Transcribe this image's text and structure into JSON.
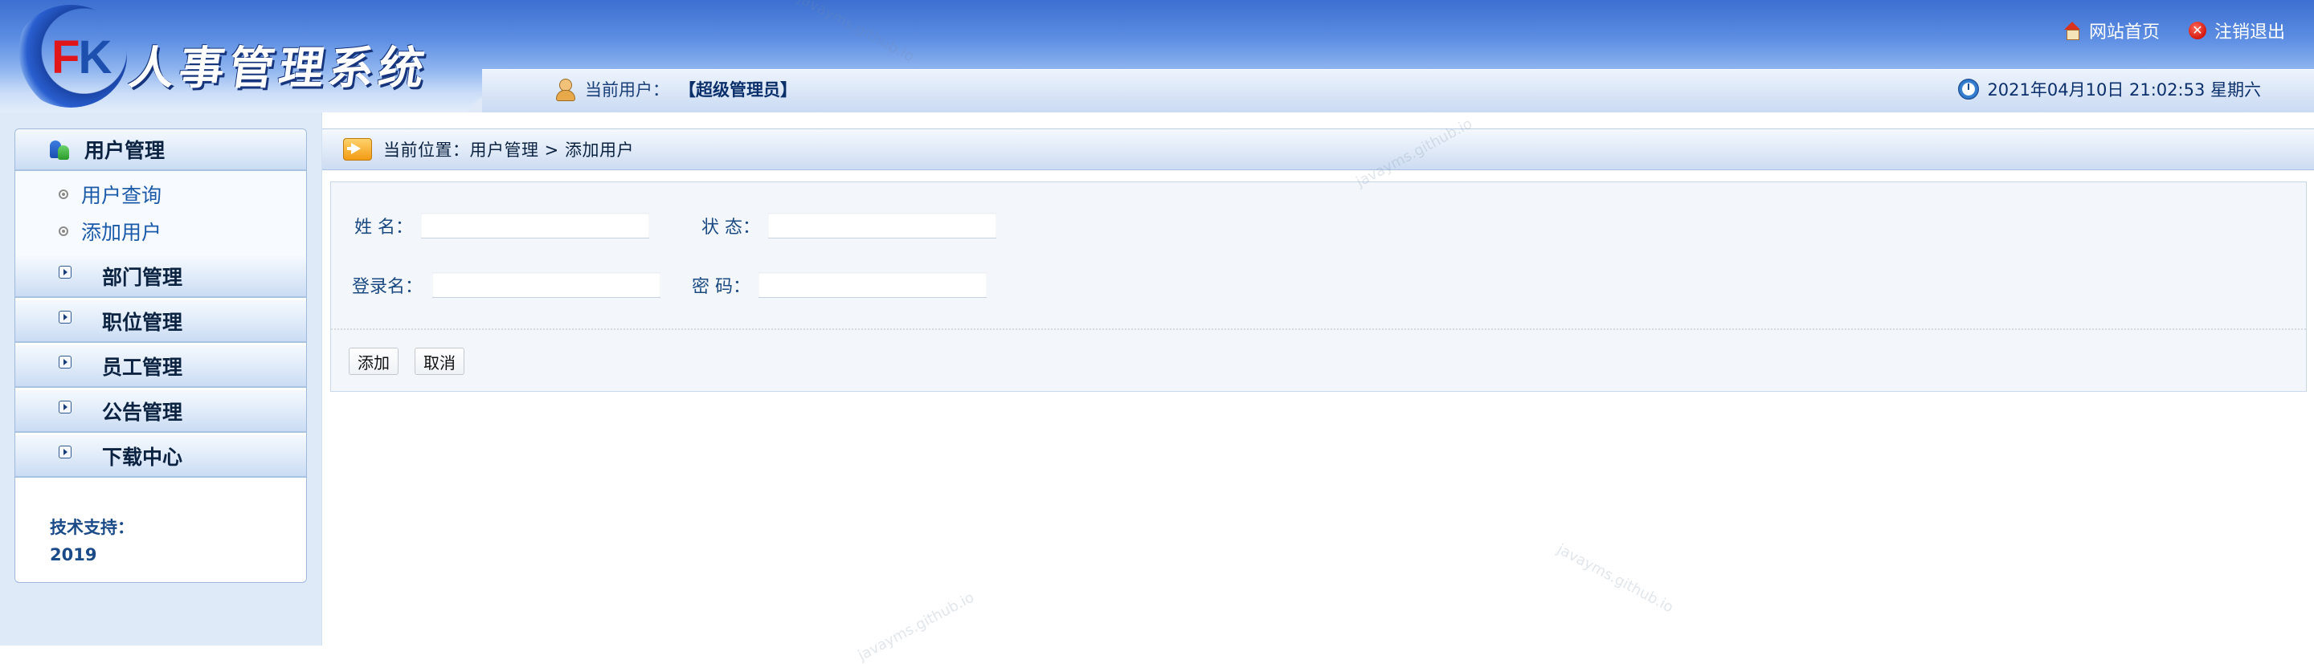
{
  "app": {
    "logo_letter_f": "F",
    "logo_letter_k": "K",
    "title": "人事管理系统"
  },
  "header": {
    "home_link": "网站首页",
    "logout_link": "注销退出",
    "current_user_label": "当前用户：",
    "current_user_role": "【超级管理员】",
    "datetime": "2021年04月10日 21:02:53 星期六"
  },
  "sidebar": {
    "sections": [
      {
        "label": "用户管理",
        "expanded": true,
        "icon": "users-icon",
        "items": [
          {
            "label": "用户查询"
          },
          {
            "label": "添加用户"
          }
        ]
      },
      {
        "label": "部门管理",
        "expanded": false,
        "icon": "arrow-icon"
      },
      {
        "label": "职位管理",
        "expanded": false,
        "icon": "arrow-icon"
      },
      {
        "label": "员工管理",
        "expanded": false,
        "icon": "arrow-icon"
      },
      {
        "label": "公告管理",
        "expanded": false,
        "icon": "arrow-icon"
      },
      {
        "label": "下载中心",
        "expanded": false,
        "icon": "arrow-icon"
      }
    ],
    "support_label": "技术支持：",
    "support_year": "2019"
  },
  "breadcrumb": {
    "text": "当前位置：用户管理 > 添加用户"
  },
  "form": {
    "name_label": "姓 名：",
    "name_value": "",
    "status_label": "状 态：",
    "status_value": "",
    "login_label": "登录名：",
    "login_value": "",
    "password_label": "密 码：",
    "password_value": ""
  },
  "buttons": {
    "add": "添加",
    "cancel": "取消"
  },
  "watermark": "javayms.github.io",
  "colors": {
    "header_blue": "#3c6fd0",
    "sidebar_bg": "#dfeaf9",
    "menu_text": "#0b2341",
    "link_blue": "#1a5aa8",
    "logo_red": "#e0161b"
  }
}
